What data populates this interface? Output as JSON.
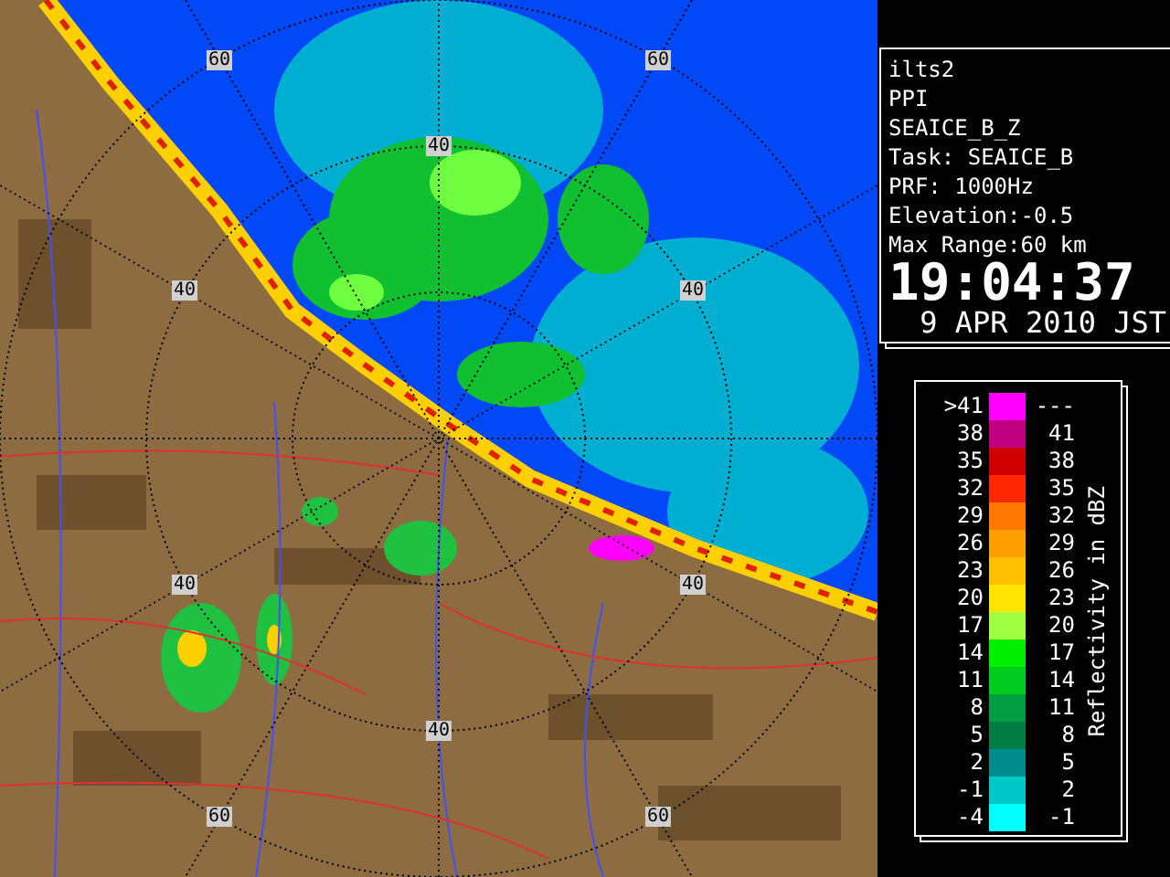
{
  "map": {
    "range_labels": [
      "60",
      "60",
      "40",
      "40",
      "40",
      "40",
      "40",
      "40",
      "60",
      "60"
    ]
  },
  "info": {
    "lines": [
      "ilts2",
      "PPI",
      "SEAICE_B_Z",
      "Task: SEAICE_B",
      "PRF: 1000Hz",
      "Elevation:-0.5",
      "Max Range:60 km"
    ],
    "time": "19:04:37",
    "date": "9 APR 2010 JST"
  },
  "legend": {
    "title": "Reflectivity in dBZ",
    "rows": [
      {
        "lower": ">41",
        "upper": "---",
        "color": "#ff00ff"
      },
      {
        "lower": "38",
        "upper": "41",
        "color": "#c00080"
      },
      {
        "lower": "35",
        "upper": "38",
        "color": "#d00000"
      },
      {
        "lower": "32",
        "upper": "35",
        "color": "#ff2800"
      },
      {
        "lower": "29",
        "upper": "32",
        "color": "#ff7800"
      },
      {
        "lower": "26",
        "upper": "29",
        "color": "#ffa000"
      },
      {
        "lower": "23",
        "upper": "26",
        "color": "#ffc000"
      },
      {
        "lower": "20",
        "upper": "23",
        "color": "#ffe400"
      },
      {
        "lower": "17",
        "upper": "20",
        "color": "#a0ff40"
      },
      {
        "lower": "14",
        "upper": "17",
        "color": "#00f000"
      },
      {
        "lower": "11",
        "upper": "14",
        "color": "#00cc20"
      },
      {
        "lower": "8",
        "upper": "11",
        "color": "#009c40"
      },
      {
        "lower": "5",
        "upper": "8",
        "color": "#007c44"
      },
      {
        "lower": "2",
        "upper": "5",
        "color": "#008c8c"
      },
      {
        "lower": "-1",
        "upper": "2",
        "color": "#00c8c8"
      },
      {
        "lower": "-4",
        "upper": "-1",
        "color": "#00ffff"
      }
    ]
  }
}
